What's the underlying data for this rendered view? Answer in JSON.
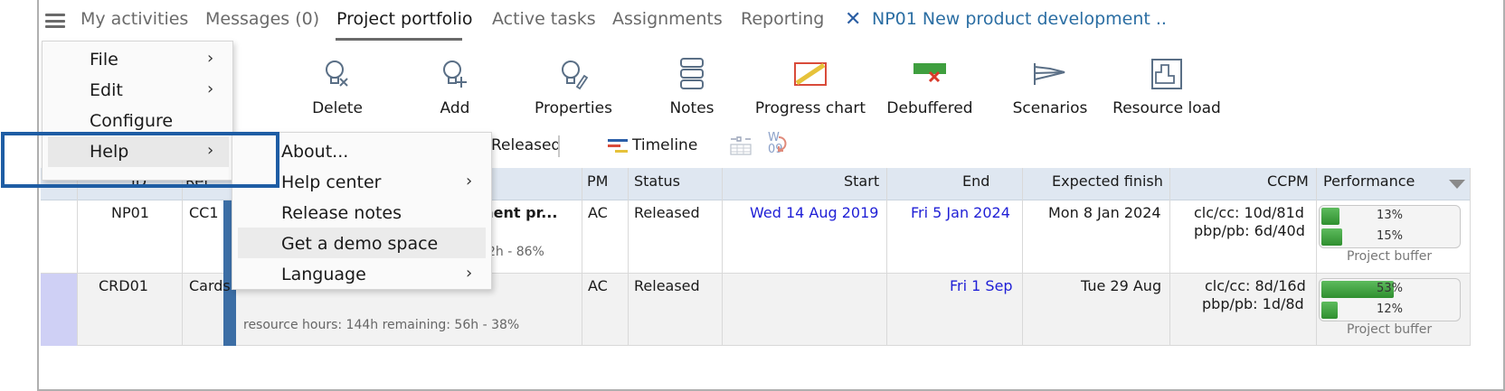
{
  "tabs": [
    {
      "label": "My activities"
    },
    {
      "label": "Messages (0)"
    },
    {
      "label": "Project portfolio"
    },
    {
      "label": "Active tasks"
    },
    {
      "label": "Assignments"
    },
    {
      "label": "Reporting"
    }
  ],
  "project_tab": {
    "label": "NP01 New product development .."
  },
  "toolbar": {
    "delete": "Delete",
    "add": "Add",
    "properties": "Properties",
    "notes": "Notes",
    "progress_chart": "Progress chart",
    "debuffered": "Debuffered",
    "scenarios": "Scenarios",
    "resource_load": "Resource load"
  },
  "secondary": {
    "released": "Released",
    "timeline": "Timeline",
    "week_label": "W",
    "week_num": "09"
  },
  "menu": {
    "items": [
      {
        "label": "File"
      },
      {
        "label": "Edit"
      },
      {
        "label": "Configure"
      },
      {
        "label": "Help"
      }
    ]
  },
  "help_menu": {
    "items": [
      {
        "label": "About..."
      },
      {
        "label": "Help center"
      },
      {
        "label": "Release notes"
      },
      {
        "label": "Get a demo space"
      },
      {
        "label": "Language"
      }
    ]
  },
  "table": {
    "headers": {
      "id": "ID",
      "ref": "Ref.",
      "pm": "PM",
      "status": "Status",
      "start": "Start",
      "end": "End",
      "expected_finish": "Expected finish",
      "ccpm": "CCPM",
      "performance": "Performance"
    },
    "rows": [
      {
        "id": "NP01",
        "ref": "CC1",
        "name_tail": "ment pr...",
        "detail_tail": "2h - 86%",
        "pm": "AC",
        "status": "Released",
        "start": "Wed 14 Aug 2019",
        "end": "Fri 5 Jan 2024",
        "expected_finish": "Mon 8 Jan 2024",
        "ccpm_line1": "clc/cc: 10d/81d",
        "ccpm_line2": "pbp/pb: 6d/40d",
        "perf_top": "13%",
        "perf_top_val": 13,
        "perf_bottom": "15%",
        "perf_bottom_val": 15,
        "perf_caption": "Project buffer"
      },
      {
        "id": "CRD01",
        "ref": "Cards",
        "detail": "resource hours: 144h remaining: 56h - 38%",
        "pm": "AC",
        "status": "Released",
        "start": "",
        "end": "Fri 1 Sep",
        "expected_finish": "Tue 29 Aug",
        "ccpm_line1": "clc/cc: 8d/16d",
        "ccpm_line2": "pbp/pb: 1d/8d",
        "perf_top": "53%",
        "perf_top_val": 53,
        "perf_bottom": "12%",
        "perf_bottom_val": 12,
        "perf_caption": "Project buffer"
      }
    ]
  }
}
